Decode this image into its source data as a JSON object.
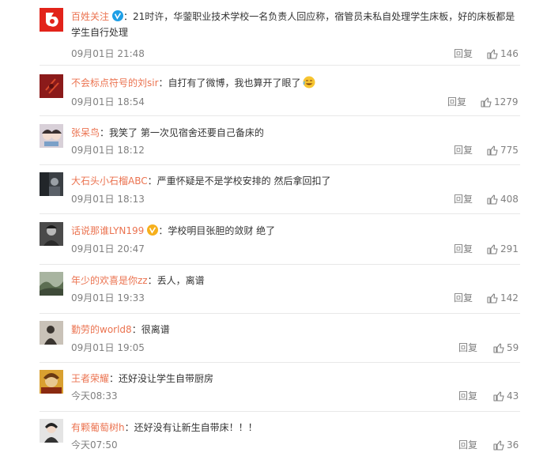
{
  "ui": {
    "reply_label": "回复"
  },
  "comments": [
    {
      "username": "百姓关注",
      "verified": true,
      "text": "21时许，华蓥职业技术学校一名负责人回应称，宿管员未私自处理学生床板，好的床板都是学生自行处理",
      "time": "09月01日 21:48",
      "likes": "146",
      "avatar_color": "#e2231a"
    },
    {
      "username": "不会标点符号的刘sir",
      "verified": false,
      "text": "自打有了微博，我也算开了眼了",
      "emoji": "laugh-cry-emoji",
      "time": "09月01日 18:54",
      "likes": "1279",
      "avatar_color": "#8b1a1a"
    },
    {
      "username": "张呆鸟",
      "verified": false,
      "text": "我笑了 第一次见宿舍还要自己备床的",
      "time": "09月01日 18:12",
      "likes": "775",
      "avatar_color": "#d8d0d8"
    },
    {
      "username": "大石头小石榴ABC",
      "verified": false,
      "text": "严重怀疑是不是学校安排的 然后拿回扣了",
      "time": "09月01日 18:13",
      "likes": "408",
      "avatar_color": "#3a3f44"
    },
    {
      "username": "话说那谁LYN199",
      "verified": true,
      "verified_style": "gold",
      "text": "学校明目张胆的敛财 绝了",
      "time": "09月01日 20:47",
      "likes": "291",
      "avatar_color": "#4a4a4a"
    },
    {
      "username": "年少的欢喜是你zz",
      "verified": false,
      "text": "丢人，离谱",
      "time": "09月01日 19:33",
      "likes": "142",
      "avatar_color": "#7d8f76"
    },
    {
      "username": "勤劳的world8",
      "verified": false,
      "text": "很离谱",
      "time": "09月01日 19:05",
      "likes": "59",
      "avatar_color": "#c9c2b8"
    },
    {
      "username": "王者荣耀",
      "verified": false,
      "text": "还好没让学生自带厨房",
      "time": "今天08:33",
      "likes": "43",
      "avatar_color": "#d9a030"
    },
    {
      "username": "有颗葡萄树h",
      "verified": false,
      "text": "还好没有让新生自带床！！！",
      "time": "今天07:50",
      "likes": "36",
      "avatar_color": "#e4e4e4"
    }
  ],
  "colors": {
    "username": "#eb7350",
    "meta": "#808080",
    "text": "#333333",
    "verified_blue": "#1e9fe6",
    "verified_gold": "#f6b01c"
  }
}
